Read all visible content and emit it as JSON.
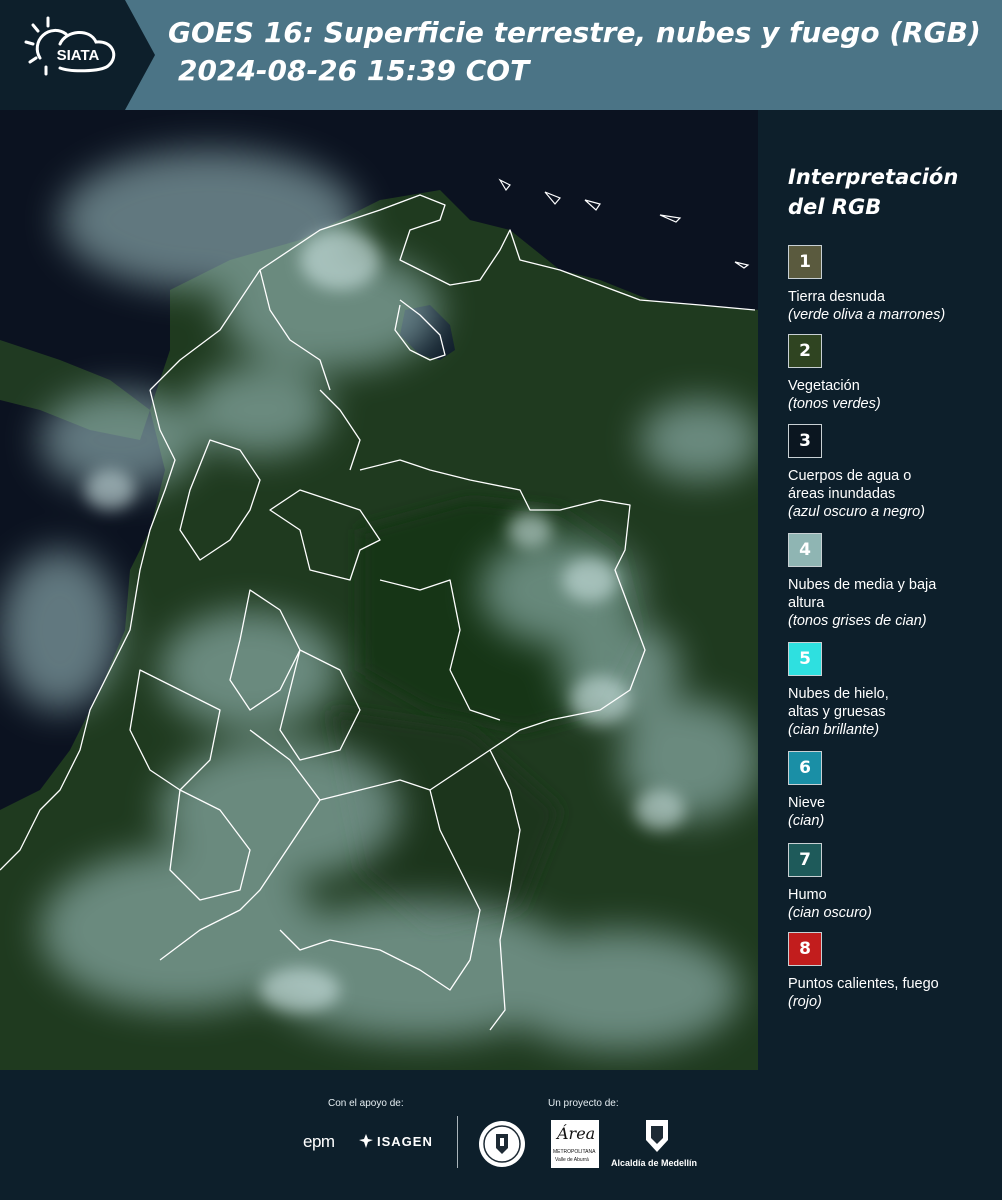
{
  "header": {
    "brand": "SIATA",
    "title_line1": "GOES 16: Superficie terrestre, nubes y fuego (RGB)",
    "title_line2": "2024-08-26 15:39 COT"
  },
  "legend": {
    "title": "Interpretación del RGB",
    "items": [
      {
        "number": "1",
        "label": "Tierra desnuda",
        "sub": "(verde oliva a marrones)",
        "color": "#5a5a3e"
      },
      {
        "number": "2",
        "label": "Vegetación",
        "sub": "(tonos verdes)",
        "color": "#2f4421"
      },
      {
        "number": "3",
        "label": "Cuerpos de agua o áreas inundadas",
        "sub": "(azul oscuro a negro)",
        "color": "#0b1620"
      },
      {
        "number": "4",
        "label": "Nubes de media y baja altura",
        "sub": "(tonos grises de cian)",
        "color": "#8fb5b3"
      },
      {
        "number": "5",
        "label": "Nubes de hielo, altas y gruesas",
        "sub": "(cian brillante)",
        "color": "#2ee0e0"
      },
      {
        "number": "6",
        "label": "Nieve",
        "sub": "(cian)",
        "color": "#1a8fa6"
      },
      {
        "number": "7",
        "label": "Humo",
        "sub": "(cian oscuro)",
        "color": "#1e5a5a"
      },
      {
        "number": "8",
        "label": "Puntos calientes, fuego",
        "sub": "(rojo)",
        "color": "#c21d1d"
      }
    ]
  },
  "footer": {
    "support_caption": "Con el apoyo de:",
    "project_caption": "Un proyecto de:",
    "epm": "epm",
    "isagen": "ISAGEN",
    "area_name": "Área",
    "area_sub1": "METROPOLITANA",
    "area_sub2": "Valle de Aburrá",
    "alcaldia": "Alcaldía de Medellín"
  },
  "colors": {
    "header_bg": "#4b7486",
    "panel_bg": "#0d1f2b"
  }
}
